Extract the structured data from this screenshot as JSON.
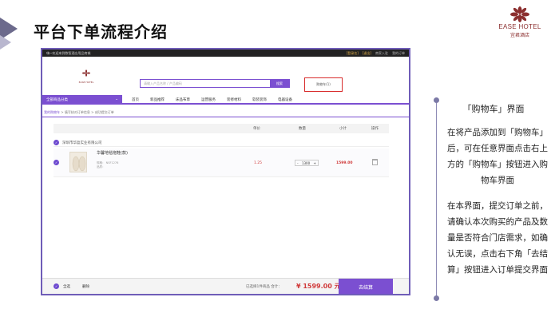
{
  "slide": {
    "title": "平台下单流程介绍"
  },
  "brand": {
    "name_en": "EASE HOTEL",
    "name_cn": "宜君酒店"
  },
  "site": {
    "welcome": "嗨~欢迎来到数智酒店用品商城",
    "topbar_links": [
      "[登录名]",
      "[退出]",
      "商家入驻",
      "我的订单"
    ],
    "logo_text": "EASE HOTEL",
    "search_placeholder": "请输入产品名称 / 产品编码",
    "search_button": "搜索",
    "cart_button": "购物车(1)",
    "nav_category": "全部商品分类",
    "nav_items": [
      "首页",
      "新品推荐",
      "床品布草",
      "运营服务",
      "装修材料",
      "软装装饰",
      "电器设备"
    ],
    "breadcrumb": [
      "我的购物车",
      "填写核对订单信息",
      "成功提交订单"
    ],
    "table_headers": [
      "单价",
      "数量",
      "小计",
      "操作"
    ],
    "shop_name": "深圳市华盈实业有限公司",
    "product": {
      "name": "华馨地毯拖鞋(款)",
      "meta1": "规格： NSF1276",
      "meta2": "品质：",
      "price": "1.25",
      "qty": "1300",
      "subtotal": "1599.00"
    },
    "footer": {
      "select_all": "全选",
      "delete": "删除",
      "summary": "已选择1件商品 合计：",
      "total": "¥ 1599.00 元",
      "checkout": "去结算"
    }
  },
  "panel": {
    "title": "「购物车」界面",
    "paragraph1": "在将产品添加到「购物车」后，可在任意界面点击右上方的「购物车」按钮进入购物车界面",
    "paragraph2": "在本界面，提交订单之前，请确认本次购买的产品及数量是否符合门店需求，如确认无误，点击右下角「去结算」按钮进入订单提交界面"
  },
  "colors": {
    "accent": "#7b4fd1",
    "brand": "#8b2e2e",
    "price": "#d03a3a"
  }
}
